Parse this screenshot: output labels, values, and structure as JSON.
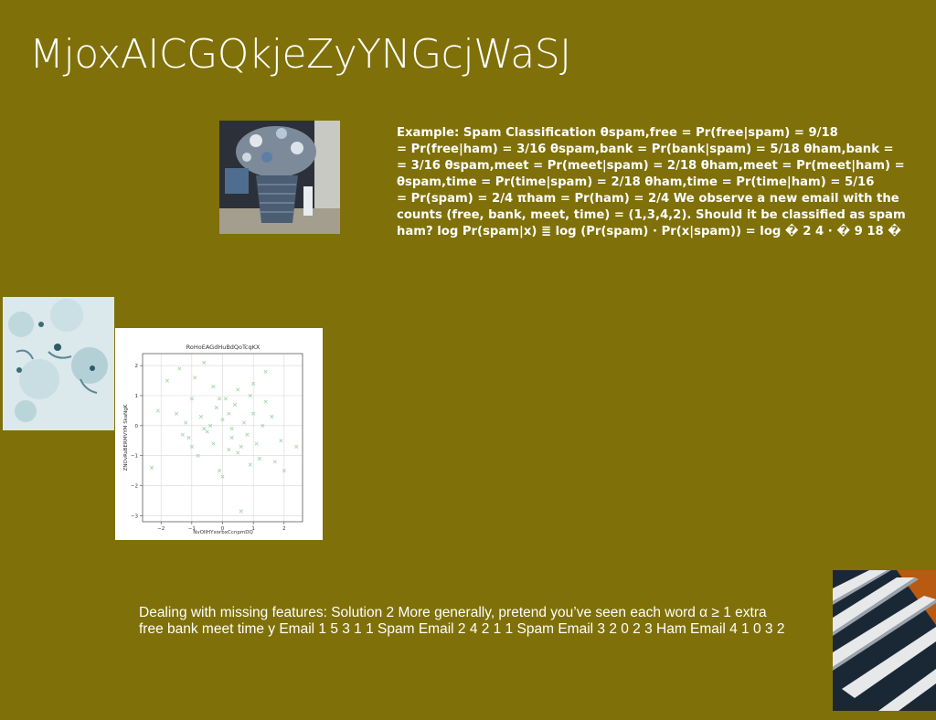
{
  "slide": {
    "title": "MjoxAICGQkjeZyYNGcjWaSJ",
    "example_lines": [
      "Example: Spam Classification θspam,free = Pr(free|spam) = 9/18",
      "= Pr(free|ham) = 3/16 θspam,bank = Pr(bank|spam) = 5/18 θham,bank =",
      "= 3/16 θspam,meet = Pr(meet|spam) = 2/18 θham,meet = Pr(meet|ham) =",
      "θspam,time = Pr(time|spam) = 2/18 θham,time = Pr(time|ham) = 5/16",
      "= Pr(spam) = 2/4 πham = Pr(ham) = 2/4 We observe a new email with the",
      "counts (free, bank, meet, time) = (1,3,4,2). Should it be classified as spam",
      "ham? log Pr(spam|x) ≣ log (Pr(spam) · Pr(x|spam)) = log � 2 4 · � 9 18 �"
    ],
    "bottom_lines": [
      "Dealing with missing features: Solution 2 More generally, pretend you’ve seen each word α ≥ 1 extra",
      "free bank meet time y Email 1 5 3 1 1 Spam Email 2 4 2 1 1 Spam Email 3 2 0 2 3 Ham Email 4 1 0 3 2"
    ]
  },
  "images": {
    "basket": "basket-photo",
    "wash": "watercolor-photo",
    "arch": "architecture-photo"
  },
  "colors": {
    "background": "#7f7009",
    "text": "#ffffff",
    "marker": "#9fd3a9"
  },
  "chart_data": {
    "type": "scatter",
    "title": "RoHoEAGdHuBdQoTcqKX",
    "xlabel": "NvOlIHYxorbxCcnpmDQ",
    "ylabel": "ZNOvRsBERMVYM SkaNgK",
    "xlim": [
      -2.6,
      2.6
    ],
    "ylim": [
      -3.2,
      2.4
    ],
    "xticks": [
      -2,
      -1,
      0,
      1,
      2
    ],
    "yticks": [
      -3,
      -2,
      -1,
      0,
      1,
      2
    ],
    "grid": true,
    "marker": "x",
    "points": [
      [
        -2.1,
        0.5
      ],
      [
        -2.3,
        -1.4
      ],
      [
        -1.8,
        1.5
      ],
      [
        -1.5,
        0.4
      ],
      [
        -1.4,
        1.9
      ],
      [
        -1.2,
        0.1
      ],
      [
        -1.1,
        -0.4
      ],
      [
        -1.0,
        -0.7
      ],
      [
        -1.0,
        0.9
      ],
      [
        -0.9,
        1.6
      ],
      [
        -0.8,
        -1.0
      ],
      [
        -0.7,
        0.3
      ],
      [
        -0.6,
        2.1
      ],
      [
        -0.5,
        -0.2
      ],
      [
        -0.4,
        0.0
      ],
      [
        -0.3,
        1.3
      ],
      [
        -0.3,
        -0.6
      ],
      [
        -0.2,
        0.6
      ],
      [
        -0.1,
        -1.5
      ],
      [
        0.0,
        0.2
      ],
      [
        0.0,
        -1.7
      ],
      [
        0.1,
        0.9
      ],
      [
        0.2,
        -0.8
      ],
      [
        0.2,
        0.4
      ],
      [
        0.3,
        -0.1
      ],
      [
        0.4,
        0.7
      ],
      [
        0.5,
        -0.9
      ],
      [
        0.5,
        1.2
      ],
      [
        0.6,
        -0.7
      ],
      [
        0.6,
        -2.85
      ],
      [
        0.7,
        0.1
      ],
      [
        0.8,
        -0.3
      ],
      [
        0.9,
        1.0
      ],
      [
        0.9,
        -1.3
      ],
      [
        1.0,
        1.4
      ],
      [
        1.0,
        0.4
      ],
      [
        1.1,
        -0.6
      ],
      [
        1.2,
        -1.1
      ],
      [
        1.3,
        0.0
      ],
      [
        1.4,
        0.8
      ],
      [
        1.4,
        1.8
      ],
      [
        1.6,
        0.3
      ],
      [
        1.7,
        -1.2
      ],
      [
        1.9,
        -0.5
      ],
      [
        2.0,
        -1.5
      ],
      [
        2.4,
        -0.7
      ],
      [
        -0.1,
        0.9
      ],
      [
        -0.6,
        -0.1
      ],
      [
        -1.3,
        -0.3
      ],
      [
        0.3,
        -0.4
      ]
    ]
  }
}
